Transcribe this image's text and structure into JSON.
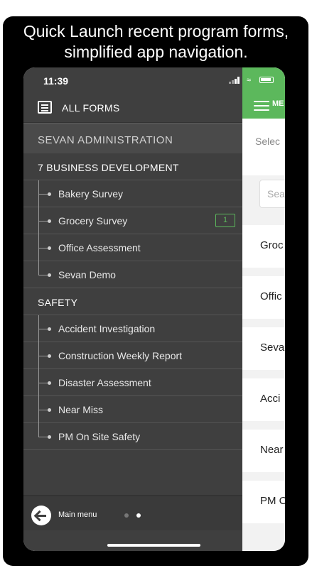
{
  "headline": "Quick Launch recent program forms,\nsimplified app navigation.",
  "status_bar": {
    "time": "11:39"
  },
  "drawer": {
    "all_forms_label": "ALL FORMS",
    "organization": "SEVAN ADMINISTRATION",
    "sections": [
      {
        "title": "7 BUSINESS DEVELOPMENT",
        "items": [
          {
            "label": "Bakery Survey",
            "badge": ""
          },
          {
            "label": "Grocery Survey",
            "badge": "1"
          },
          {
            "label": "Office Assessment",
            "badge": ""
          },
          {
            "label": "Sevan Demo",
            "badge": ""
          }
        ]
      },
      {
        "title": "SAFETY",
        "items": [
          {
            "label": "Accident Investigation",
            "badge": ""
          },
          {
            "label": "Construction Weekly Report",
            "badge": ""
          },
          {
            "label": "Disaster Assessment",
            "badge": ""
          },
          {
            "label": "Near Miss",
            "badge": ""
          },
          {
            "label": "PM On Site Safety",
            "badge": ""
          }
        ]
      }
    ],
    "footer": {
      "main_menu_label": "Main menu",
      "page_dots": {
        "count": 2,
        "active": 1
      }
    }
  },
  "background_app": {
    "menu_label": "ME",
    "select_text": "Selec",
    "search_placeholder": "Sea",
    "rows": [
      "Groc",
      "Offic",
      "Seva",
      "Acci",
      "Near",
      "PM C"
    ]
  },
  "colors": {
    "accent_green": "#5cb85c",
    "drawer_bg": "#3f3f3f",
    "frame_bg": "#000000"
  }
}
